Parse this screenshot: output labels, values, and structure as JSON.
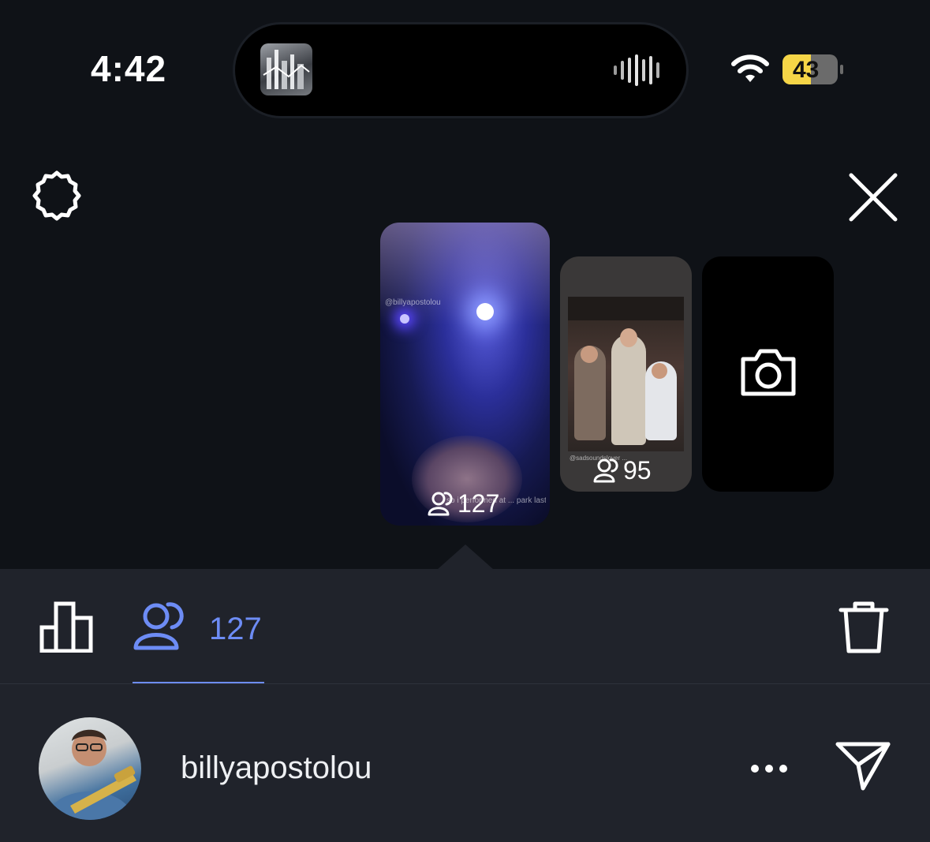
{
  "status_bar": {
    "time": "4:42",
    "battery_level": "43",
    "battery_color": "#f5d547",
    "wifi_icon": "wifi-icon"
  },
  "toolbar": {
    "settings_icon": "gear-icon",
    "close_icon": "close-icon"
  },
  "stories": [
    {
      "viewer_count": "127",
      "selected": true,
      "watermark": "@billyapostolou",
      "caption": "so i performed at ... park last night"
    },
    {
      "viewer_count": "95",
      "selected": false,
      "watermark": "@sadsoundslover ..."
    }
  ],
  "add_story_icon": "camera-icon",
  "tabs": {
    "insights_icon": "bar-chart-icon",
    "viewers_icon": "viewers-icon",
    "viewers_count": "127",
    "delete_icon": "trash-icon",
    "accent": "#6d8cf5"
  },
  "viewer_list": [
    {
      "username": "billyapostolou",
      "more_icon": "ellipsis-icon",
      "send_icon": "send-icon"
    }
  ]
}
